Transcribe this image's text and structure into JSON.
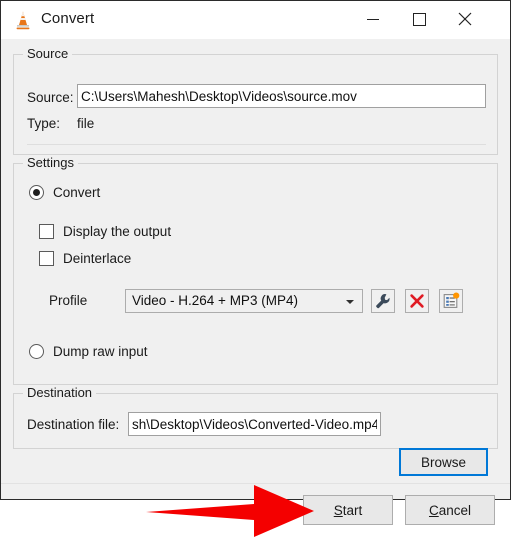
{
  "window": {
    "title": "Convert",
    "app_icon": "vlc-cone-icon",
    "controls": {
      "minimize": "minimize-icon",
      "maximize": "maximize-icon",
      "close": "close-icon"
    }
  },
  "source_group": {
    "legend": "Source",
    "source_label": "Source:",
    "source_value": "C:\\Users\\Mahesh\\Desktop\\Videos\\source.mov",
    "source_placeholder": "",
    "type_label": "Type:",
    "type_value": "file"
  },
  "settings_group": {
    "legend": "Settings",
    "convert_radio": {
      "label": "Convert",
      "selected": true
    },
    "display_output_checkbox": {
      "label": "Display the output",
      "checked": false
    },
    "deinterlace_checkbox": {
      "label": "Deinterlace",
      "checked": false
    },
    "profile_label": "Profile",
    "profile_selected": "Video - H.264 + MP3 (MP4)",
    "profile_options": [
      "Video - H.264 + MP3 (MP4)"
    ],
    "profile_edit_icon": "wrench-icon",
    "profile_delete_icon": "red-x-icon",
    "profile_new_icon": "new-profile-icon",
    "dump_raw_radio": {
      "label": "Dump raw input",
      "selected": false
    }
  },
  "destination_group": {
    "legend": "Destination",
    "file_label": "Destination file:",
    "file_value": "sh\\Desktop\\Videos\\Converted-Video.mp4",
    "file_placeholder": "",
    "browse_label": "Browse"
  },
  "footer": {
    "start_label": "Start",
    "start_accel": "S",
    "start_rest": "tart",
    "cancel_label": "Cancel",
    "cancel_accel": "C",
    "cancel_rest": "ancel"
  },
  "annotation": {
    "arrow": "red-arrow-pointing-right",
    "color": "#f40000",
    "points_at": "Start"
  },
  "colors": {
    "dialog_background": "#f0f0f0",
    "titlebar_background": "#ffffff",
    "text": "#1a1a1a",
    "focus_blue": "#0078d7",
    "accent_orange": "#ff8800",
    "delete_red": "#e01b24",
    "annotation_red": "#f40000"
  }
}
